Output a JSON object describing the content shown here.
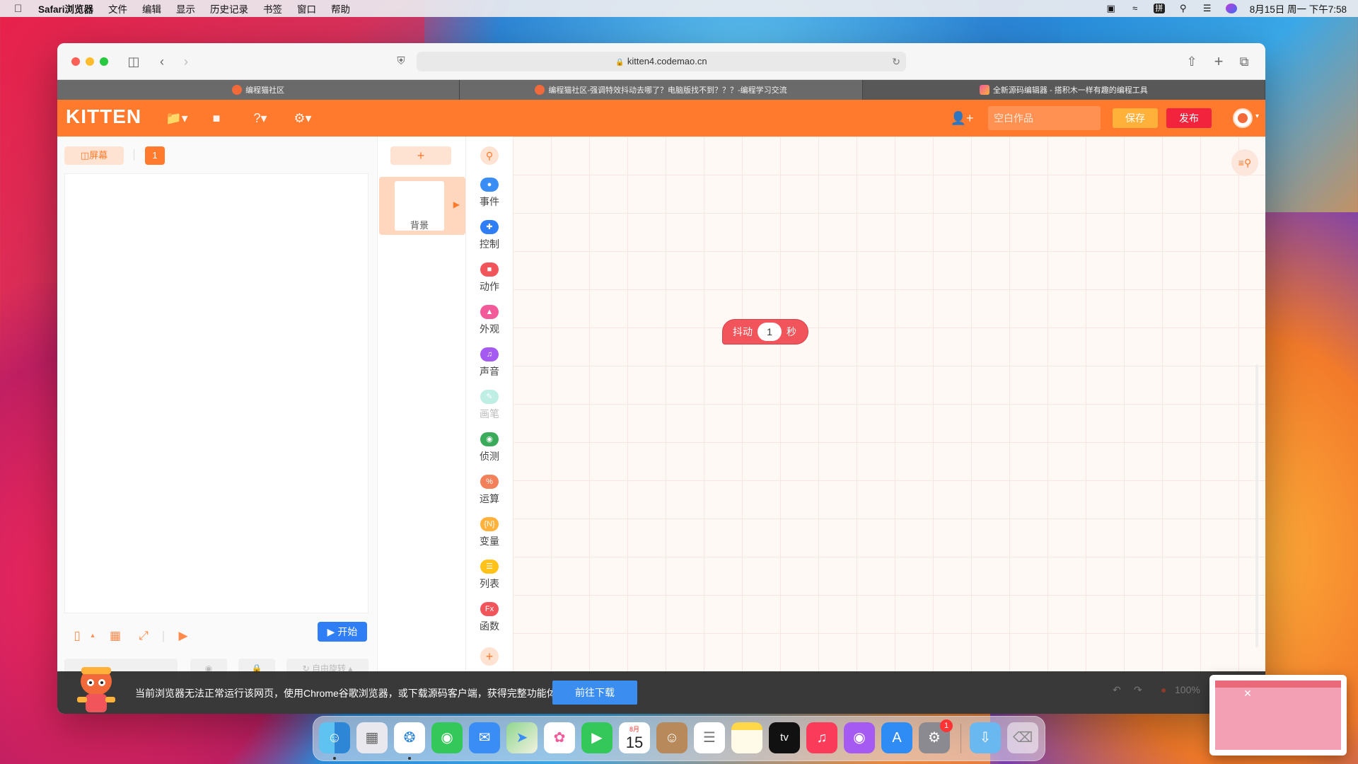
{
  "menubar": {
    "app": "Safari浏览器",
    "items": [
      "文件",
      "编辑",
      "显示",
      "历史记录",
      "书签",
      "窗口",
      "帮助"
    ],
    "input_method": "拼",
    "clock": "8月15日 周一 下午7:58"
  },
  "browser": {
    "url": "kitten4.codemao.cn",
    "tabs": [
      {
        "title": "编程猫社区"
      },
      {
        "title": "编程猫社区-强调特效抖动去哪了？电脑版找不到？？？-编程学习交流"
      },
      {
        "title": "全新源码编辑器 - 搭积木一样有趣的编程工具"
      }
    ]
  },
  "kitten": {
    "logo": "KITTEN",
    "project_placeholder": "空白作品",
    "save_label": "保存",
    "publish_label": "发布"
  },
  "stage": {
    "screen_label": "屏幕",
    "screen_number": "1",
    "start_label": "开始",
    "rotate_label": "自由旋转"
  },
  "sprites": {
    "add_label": "+",
    "background_label": "背景"
  },
  "categories": [
    {
      "label": "事件",
      "color": "#3a8df5",
      "icon": "event-icon"
    },
    {
      "label": "控制",
      "color": "#2f7ef5",
      "icon": "control-icon"
    },
    {
      "label": "动作",
      "color": "#f2545b",
      "icon": "motion-icon"
    },
    {
      "label": "外观",
      "color": "#f25a9a",
      "icon": "looks-icon"
    },
    {
      "label": "声音",
      "color": "#a55af2",
      "icon": "sound-icon"
    },
    {
      "label": "画笔",
      "color": "#7ed8c8",
      "icon": "pen-icon"
    },
    {
      "label": "侦测",
      "color": "#3aab5a",
      "icon": "sensing-icon"
    },
    {
      "label": "运算",
      "color": "#f2805a",
      "icon": "operator-icon"
    },
    {
      "label": "变量",
      "color": "#ffb13a",
      "icon": "variable-icon"
    },
    {
      "label": "列表",
      "color": "#ffc21a",
      "icon": "list-icon"
    },
    {
      "label": "函数",
      "color": "#f2545b",
      "icon": "function-icon"
    }
  ],
  "workspace": {
    "block": {
      "label_before": "抖动",
      "value": "1",
      "label_after": "秒",
      "color": "#f2545b"
    },
    "zoom": "100%"
  },
  "notice": {
    "message": "当前浏览器无法正常运行该网页，使用Chrome谷歌浏览器，或下载源码客户端，获得完整功能体验。",
    "download_label": "前往下载"
  },
  "dock": {
    "calendar_month": "8月",
    "calendar_day": "15",
    "settings_badge": "1",
    "tv_label": "tv"
  }
}
